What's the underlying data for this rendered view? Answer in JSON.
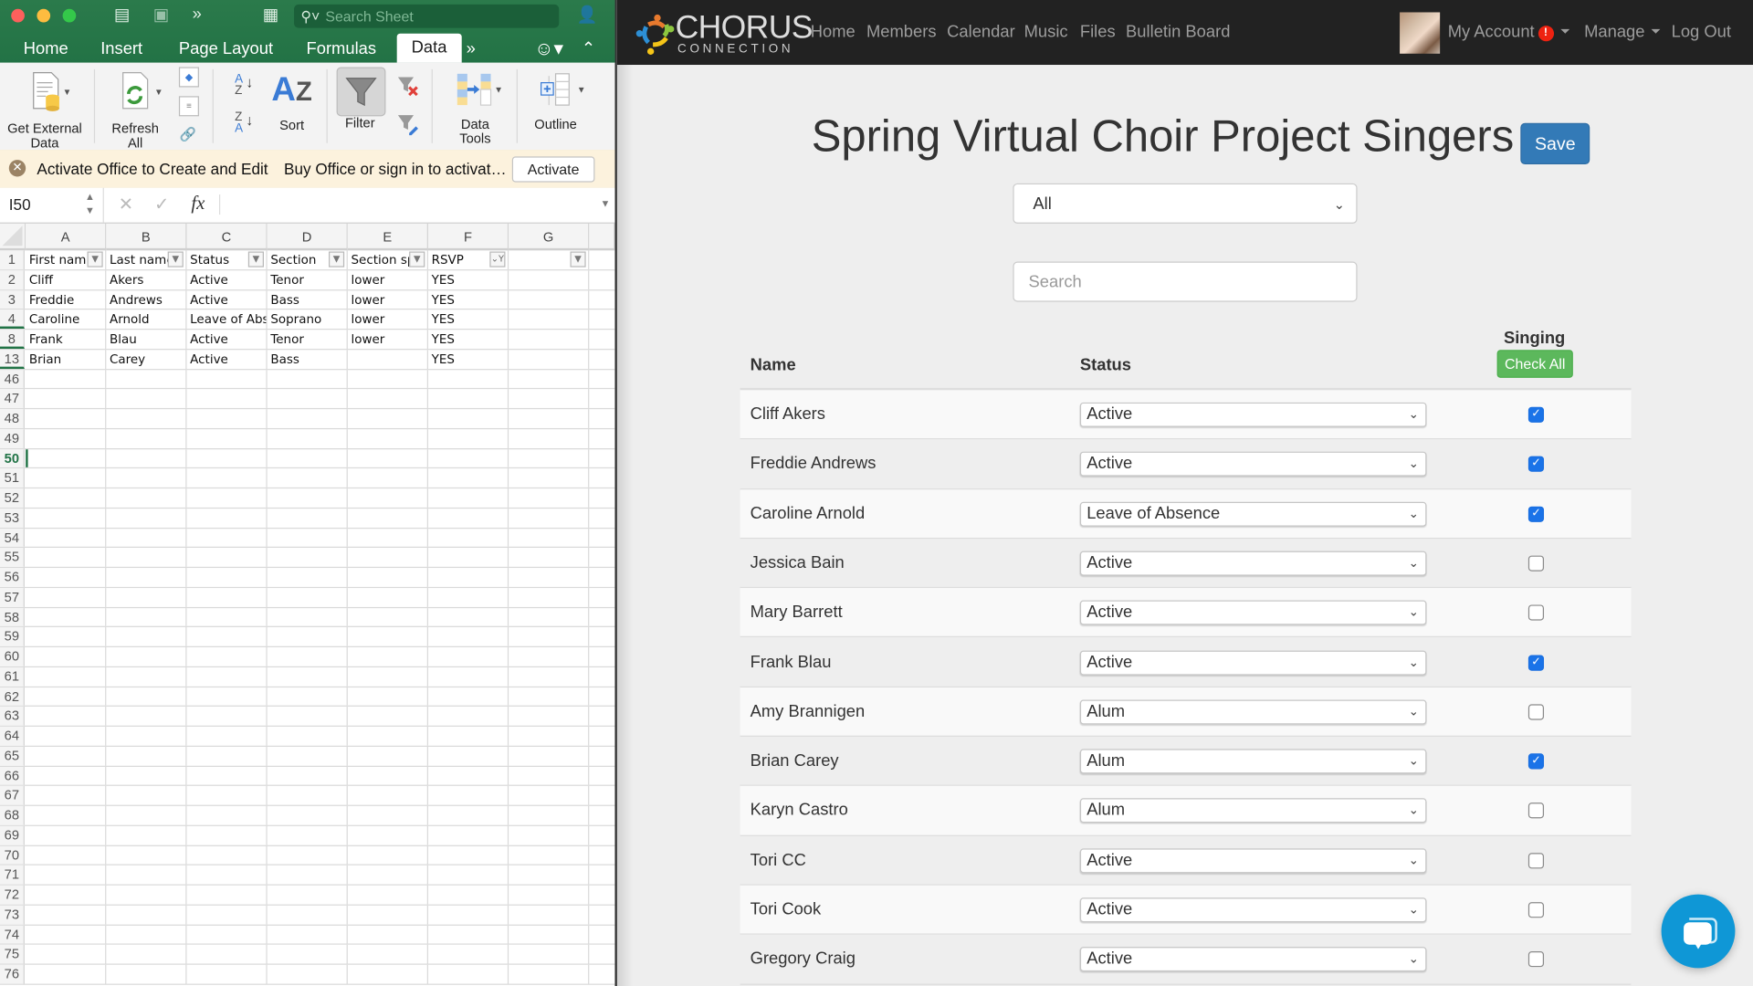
{
  "excel": {
    "search_placeholder": "Search Sheet",
    "tabs": [
      {
        "label": "Home"
      },
      {
        "label": "Insert"
      },
      {
        "label": "Page Layout"
      },
      {
        "label": "Formulas"
      },
      {
        "label": "Data",
        "active": true
      }
    ],
    "ribbon": {
      "get_external_data": "Get External\nData",
      "get_external_data_l1": "Get External",
      "get_external_data_l2": "Data",
      "refresh_l1": "Refresh",
      "refresh_l2": "All",
      "sort": "Sort",
      "filter": "Filter",
      "data_tools_l1": "Data",
      "data_tools_l2": "Tools",
      "outline": "Outline"
    },
    "message_bar": {
      "title": "Activate Office to Create and Edit",
      "detail": "Buy Office or sign in to activat…",
      "button": "Activate"
    },
    "name_box": "I50",
    "fx_label": "fx",
    "columns": [
      "A",
      "B",
      "C",
      "D",
      "E",
      "F",
      "G"
    ],
    "header_row": {
      "num": "1",
      "cells": [
        "First nam",
        "Last name",
        "Status",
        "Section",
        "Section sp",
        "RSVP",
        ""
      ]
    },
    "data_rows": [
      {
        "num": "2",
        "cells": [
          "Cliff",
          "Akers",
          "Active",
          "Tenor",
          "lower",
          "YES",
          ""
        ]
      },
      {
        "num": "3",
        "cells": [
          "Freddie",
          "Andrews",
          "Active",
          "Bass",
          "lower",
          "YES",
          ""
        ]
      },
      {
        "num": "4",
        "cells": [
          "Caroline",
          "Arnold",
          "Leave of Abs",
          "Soprano",
          "lower",
          "YES",
          ""
        ]
      },
      {
        "num": "8",
        "cells": [
          "Frank",
          "Blau",
          "Active",
          "Tenor",
          "lower",
          "YES",
          ""
        ]
      },
      {
        "num": "13",
        "cells": [
          "Brian",
          "Carey",
          "Active",
          "Bass",
          "",
          "YES",
          ""
        ]
      }
    ],
    "empty_rows": [
      "46",
      "47",
      "48",
      "49",
      "50",
      "51",
      "52",
      "53",
      "54",
      "55",
      "56",
      "57",
      "58",
      "59",
      "60",
      "61",
      "62",
      "63",
      "64",
      "65",
      "66",
      "67",
      "68",
      "69",
      "70",
      "71",
      "72",
      "73",
      "74",
      "75",
      "76"
    ],
    "selected_row": "50"
  },
  "site": {
    "logo_main": "CHORUS",
    "logo_sub": "CONNECTION",
    "nav": [
      "Home",
      "Members",
      "Calendar",
      "Music",
      "Files",
      "Bulletin Board"
    ],
    "account": "My Account",
    "account_badge": "!",
    "manage": "Manage",
    "logout": "Log Out",
    "title": "Spring Virtual Choir Project Singers",
    "save": "Save",
    "filter_selected": "All",
    "search_placeholder": "Search",
    "table": {
      "col_name": "Name",
      "col_status": "Status",
      "col_singing": "Singing",
      "check_all": "Check All",
      "rows": [
        {
          "name": "Cliff Akers",
          "status": "Active",
          "singing": true
        },
        {
          "name": "Freddie Andrews",
          "status": "Active",
          "singing": true
        },
        {
          "name": "Caroline Arnold",
          "status": "Leave of Absence",
          "singing": true
        },
        {
          "name": "Jessica Bain",
          "status": "Active",
          "singing": false
        },
        {
          "name": "Mary Barrett",
          "status": "Active",
          "singing": false
        },
        {
          "name": "Frank Blau",
          "status": "Active",
          "singing": true
        },
        {
          "name": "Amy Brannigen",
          "status": "Alum",
          "singing": false
        },
        {
          "name": "Brian Carey",
          "status": "Alum",
          "singing": true
        },
        {
          "name": "Karyn Castro",
          "status": "Alum",
          "singing": false
        },
        {
          "name": "Tori CC",
          "status": "Active",
          "singing": false
        },
        {
          "name": "Tori Cook",
          "status": "Active",
          "singing": false
        },
        {
          "name": "Gregory Craig",
          "status": "Active",
          "singing": false
        }
      ]
    },
    "colors": {
      "primary": "#337ab7",
      "success": "#5cb85c",
      "chat": "#0f97d6",
      "nav_bg": "#222222",
      "excel_green": "#217346"
    }
  }
}
